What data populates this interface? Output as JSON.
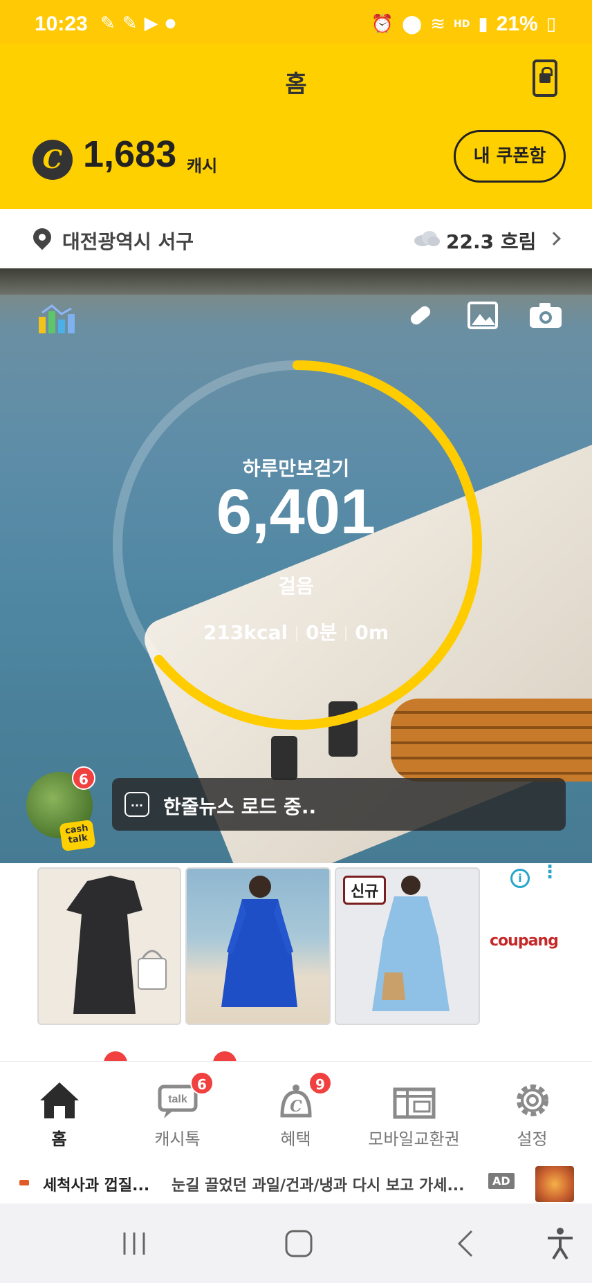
{
  "status_bar": {
    "time": "10:23",
    "battery": "21%",
    "icons": [
      "notification-icon",
      "notification-icon",
      "youtube-icon",
      "dot-icon",
      "alarm-icon",
      "location-icon",
      "wifi-icon",
      "hd-voice-icon",
      "signal-icon",
      "battery-icon"
    ]
  },
  "header": {
    "title": "홈",
    "cash_amount": "1,683",
    "cash_unit": "캐시",
    "coupon_button": "내 쿠폰함",
    "colors": {
      "brand_yellow": "#ffd000",
      "status_yellow": "#ffc906"
    }
  },
  "location_bar": {
    "location": "대전광역시 서구",
    "weather": "22.3 흐림"
  },
  "step_tracker": {
    "label": "하루만보걷기",
    "steps": "6,401",
    "unit": "걸음",
    "kcal": "213kcal",
    "minutes": "0분",
    "distance": "0m",
    "progress_fraction": 0.64,
    "ring_color": "#ffcc00"
  },
  "cash_talk": {
    "badge_count": "6",
    "badge_label": "cash talk",
    "news_text": "한줄뉴스 로드 중..",
    "news_dots": "..."
  },
  "ad_carousel": {
    "items": [
      {
        "name": "black-dress"
      },
      {
        "name": "blue-dress"
      },
      {
        "name": "lightblue-dress",
        "tag": "신규"
      }
    ],
    "brand": "coupang",
    "info_symbol": "i"
  },
  "bottom_nav": {
    "items": [
      {
        "label": "홈",
        "active": true
      },
      {
        "label": "캐시톡",
        "badge": "6"
      },
      {
        "label": "혜택",
        "badge": "9"
      },
      {
        "label": "모바일교환권"
      },
      {
        "label": "설정"
      }
    ]
  },
  "ad_banner": {
    "title": "세척사과 껍질...",
    "description": "눈길 끌었던 과일/건과/냉과 다시 보고 가세...",
    "badge": "AD"
  }
}
